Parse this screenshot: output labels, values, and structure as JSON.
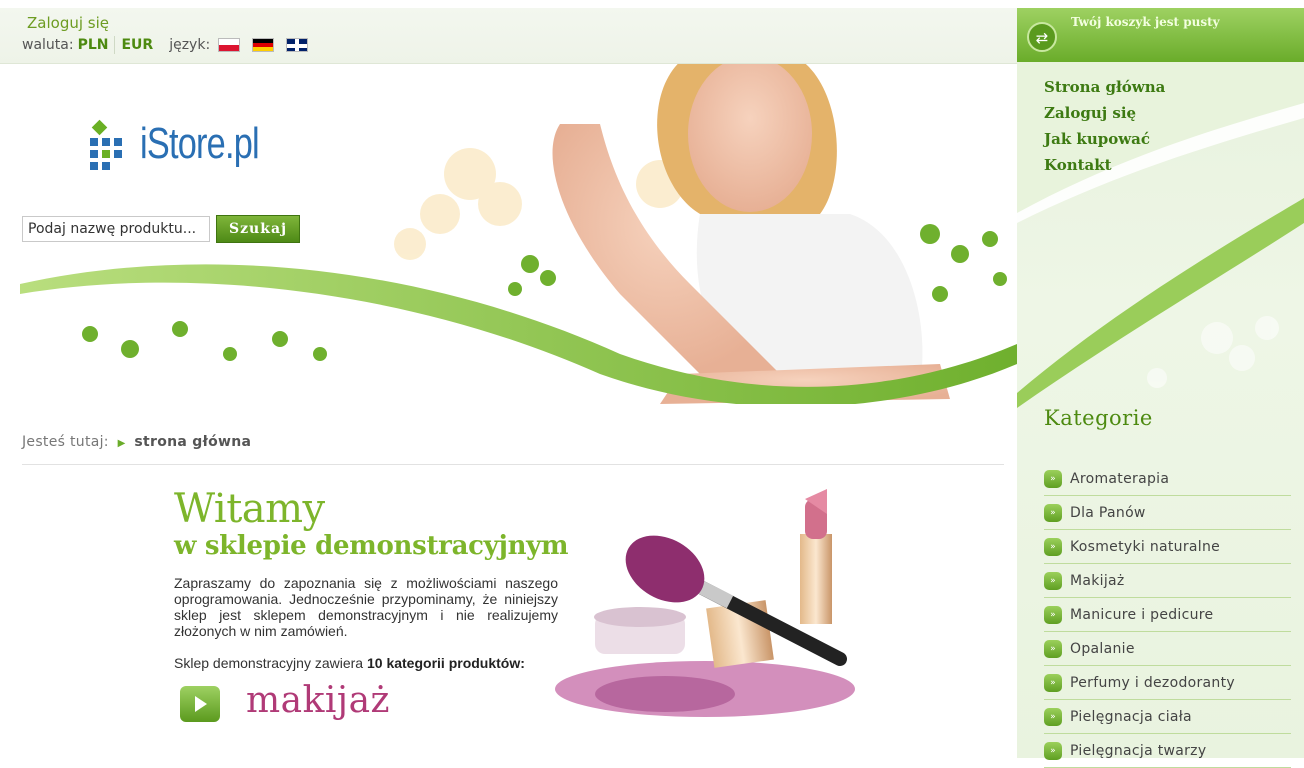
{
  "topbar": {
    "login_label": "Zaloguj się",
    "currency_label": "waluta:",
    "currency_pln": "PLN",
    "currency_eur": "EUR",
    "language_label": "język:"
  },
  "header": {
    "logo_text": "iStore.pl",
    "search": {
      "value": "Podaj nazwę produktu...",
      "button_label": "Szukaj"
    }
  },
  "cart": {
    "status": "Twój koszyk jest pusty"
  },
  "topnav": {
    "items": [
      {
        "label": "Strona główna"
      },
      {
        "label": "Zaloguj się"
      },
      {
        "label": "Jak kupować"
      },
      {
        "label": "Kontakt"
      }
    ]
  },
  "categories": {
    "title": "Kategorie",
    "items": [
      {
        "label": "Aromaterapia"
      },
      {
        "label": "Dla Panów"
      },
      {
        "label": "Kosmetyki naturalne"
      },
      {
        "label": "Makijaż"
      },
      {
        "label": "Manicure i pedicure"
      },
      {
        "label": "Opalanie"
      },
      {
        "label": "Perfumy i dezodoranty"
      },
      {
        "label": "Pielęgnacja ciała"
      },
      {
        "label": "Pielęgnacja twarzy"
      }
    ]
  },
  "breadcrumb": {
    "prefix": "Jesteś tutaj:",
    "current": "strona główna"
  },
  "welcome": {
    "title": "Witamy",
    "subtitle": "w sklepie demonstracyjnym",
    "body": "Zapraszamy do zapoznania się z możliwościami naszego oprogramowania. Jednocześnie przypominamy, że niniejszy sklep jest sklepem demonstracyjnym i nie realizujemy złożonych w nim zamówień.",
    "cats_prefix": "Sklep demonstracyjny zawiera",
    "cats_bold": "10 kategorii produktów:",
    "category_name": "makijaż"
  },
  "colors": {
    "accent_green": "#6aac2a",
    "dark_green": "#3d7a12",
    "logo_blue": "#2a6fb3",
    "makeup_pink": "#b03a77"
  }
}
